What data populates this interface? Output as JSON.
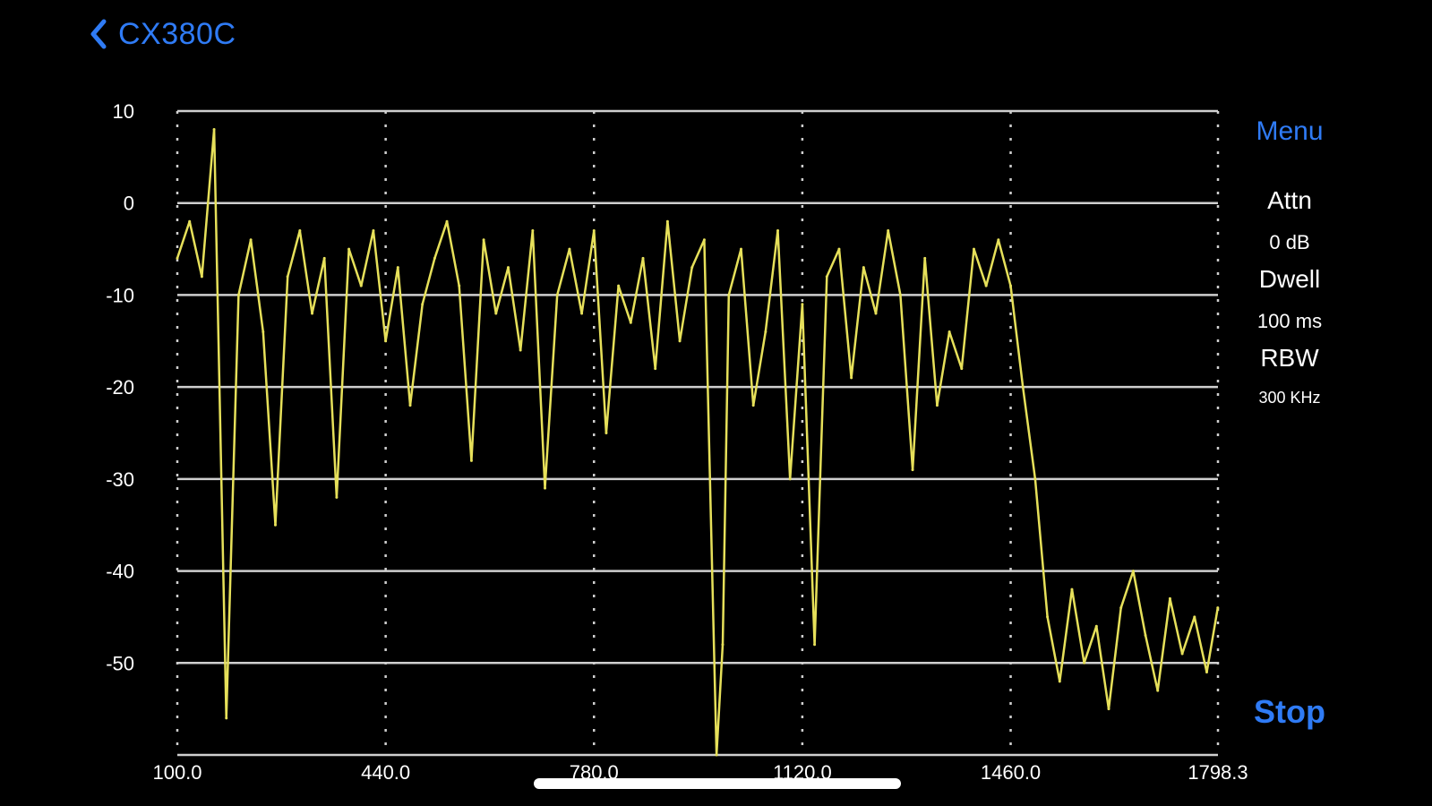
{
  "nav": {
    "back_label": "CX380C"
  },
  "controls": {
    "menu_label": "Menu",
    "stop_label": "Stop"
  },
  "settings": [
    {
      "label": "Attn",
      "value": "0 dB"
    },
    {
      "label": "Dwell",
      "value": "100 ms"
    },
    {
      "label": "RBW",
      "value": "300 KHz"
    }
  ],
  "colors": {
    "trace": "#e6e05a",
    "accent": "#2f7bf5",
    "grid": "#cfcfcf",
    "background": "#000000"
  },
  "chart_data": {
    "type": "line",
    "title": "",
    "xlabel": "",
    "ylabel": "",
    "xlim": [
      100.0,
      1798.3
    ],
    "ylim": [
      -60,
      10
    ],
    "x_ticks": [
      "100.0",
      "440.0",
      "780.0",
      "1120.0",
      "1460.0",
      "1798.3"
    ],
    "y_ticks": [
      "10",
      "0",
      "-10",
      "-20",
      "-30",
      "-40",
      "-50"
    ],
    "grid": true,
    "series": [
      {
        "color": "#e6e05a",
        "x": [
          100,
          120,
          140,
          160,
          180,
          200,
          220,
          240,
          260,
          280,
          300,
          320,
          340,
          360,
          380,
          400,
          420,
          440,
          460,
          480,
          500,
          520,
          540,
          560,
          580,
          600,
          620,
          640,
          660,
          680,
          700,
          720,
          740,
          760,
          780,
          800,
          820,
          840,
          860,
          880,
          900,
          920,
          940,
          960,
          980,
          990,
          1000,
          1020,
          1040,
          1060,
          1080,
          1100,
          1120,
          1140,
          1160,
          1180,
          1200,
          1220,
          1240,
          1260,
          1280,
          1300,
          1320,
          1340,
          1360,
          1380,
          1400,
          1420,
          1440,
          1460,
          1480,
          1500,
          1520,
          1540,
          1560,
          1580,
          1600,
          1620,
          1640,
          1660,
          1680,
          1700,
          1720,
          1740,
          1760,
          1780,
          1798
        ],
        "values": [
          -6,
          -2,
          -8,
          8,
          -56,
          -10,
          -4,
          -14,
          -35,
          -8,
          -3,
          -12,
          -6,
          -32,
          -5,
          -9,
          -3,
          -15,
          -7,
          -22,
          -11,
          -6,
          -2,
          -9,
          -28,
          -4,
          -12,
          -7,
          -16,
          -3,
          -31,
          -10,
          -5,
          -12,
          -3,
          -25,
          -9,
          -13,
          -6,
          -18,
          -2,
          -15,
          -7,
          -4,
          -60,
          -48,
          -10,
          -5,
          -22,
          -14,
          -3,
          -30,
          -11,
          -48,
          -8,
          -5,
          -19,
          -7,
          -12,
          -3,
          -10,
          -29,
          -6,
          -22,
          -14,
          -18,
          -5,
          -9,
          -4,
          -9,
          -20,
          -30,
          -45,
          -52,
          -42,
          -50,
          -46,
          -55,
          -44,
          -40,
          -47,
          -53,
          -43,
          -49,
          -45,
          -51,
          -44
        ]
      }
    ]
  }
}
